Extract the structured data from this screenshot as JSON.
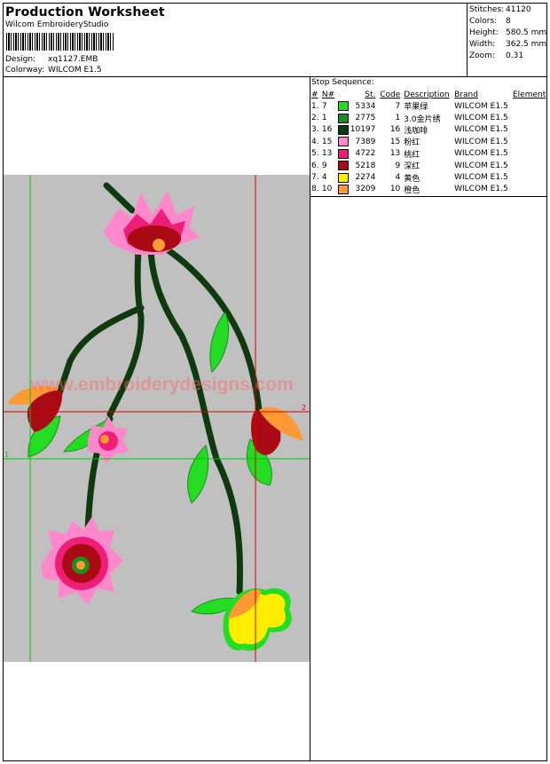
{
  "header": {
    "title": "Production Worksheet",
    "company": "Wilcom EmbroideryStudio",
    "design_label": "Design:",
    "design_value": "xq1127.EMB",
    "colorway_label": "Colorway:",
    "colorway_value": "WILCOM E1.5"
  },
  "stats": [
    {
      "label": "Stitches:",
      "value": "41120"
    },
    {
      "label": "Colors:",
      "value": "8"
    },
    {
      "label": "Height:",
      "value": "580.5 mm"
    },
    {
      "label": "Width:",
      "value": "362.5 mm"
    },
    {
      "label": "Zoom:",
      "value": "0.31"
    }
  ],
  "sequence": {
    "title": "Stop Sequence:",
    "columns": {
      "num": "#",
      "n": "N#",
      "st": "St.",
      "code": "Code",
      "desc": "Description",
      "brand": "Brand",
      "element": "Element"
    },
    "rows": [
      {
        "num": "1.",
        "n": "7",
        "color": "#22dd22",
        "st": "5334",
        "code": "7",
        "desc": "苹果绿",
        "brand": "WILCOM E1.5"
      },
      {
        "num": "2.",
        "n": "1",
        "color": "#1e8c1e",
        "st": "2775",
        "code": "1",
        "desc": "3.0金片绣",
        "brand": "WILCOM E1.5"
      },
      {
        "num": "3.",
        "n": "16",
        "color": "#0f3a0f",
        "st": "10197",
        "code": "16",
        "desc": "浅咖啡",
        "brand": "WILCOM E1.5"
      },
      {
        "num": "4.",
        "n": "15",
        "color": "#ff88cc",
        "st": "7389",
        "code": "15",
        "desc": "粉红",
        "brand": "WILCOM E1.5"
      },
      {
        "num": "5.",
        "n": "13",
        "color": "#ee1e78",
        "st": "4722",
        "code": "13",
        "desc": "桃红",
        "brand": "WILCOM E1.5"
      },
      {
        "num": "6.",
        "n": "9",
        "color": "#aa0a14",
        "st": "5218",
        "code": "9",
        "desc": "深红",
        "brand": "WILCOM E1.5"
      },
      {
        "num": "7.",
        "n": "4",
        "color": "#ffee00",
        "st": "2274",
        "code": "4",
        "desc": "黄色",
        "brand": "WILCOM E1.5"
      },
      {
        "num": "8.",
        "n": "10",
        "color": "#ff9933",
        "st": "3209",
        "code": "10",
        "desc": "橙色",
        "brand": "WILCOM E1.5"
      }
    ]
  },
  "preview": {
    "watermark": "www.embroiderydesigns.com",
    "marker_1": "1",
    "marker_2": "2",
    "colors": {
      "background": "#c0c0c0",
      "stem": "#0f3a0f",
      "leaf": "#22dd22",
      "leaf_dark": "#1e8c1e",
      "pink": "#ff88cc",
      "magenta": "#ee1e78",
      "red": "#aa0a14",
      "yellow": "#ffee00",
      "orange": "#ff9933",
      "guide_green": "#00cc00",
      "guide_red": "#dd0000",
      "watermark": "#ff6666"
    }
  }
}
